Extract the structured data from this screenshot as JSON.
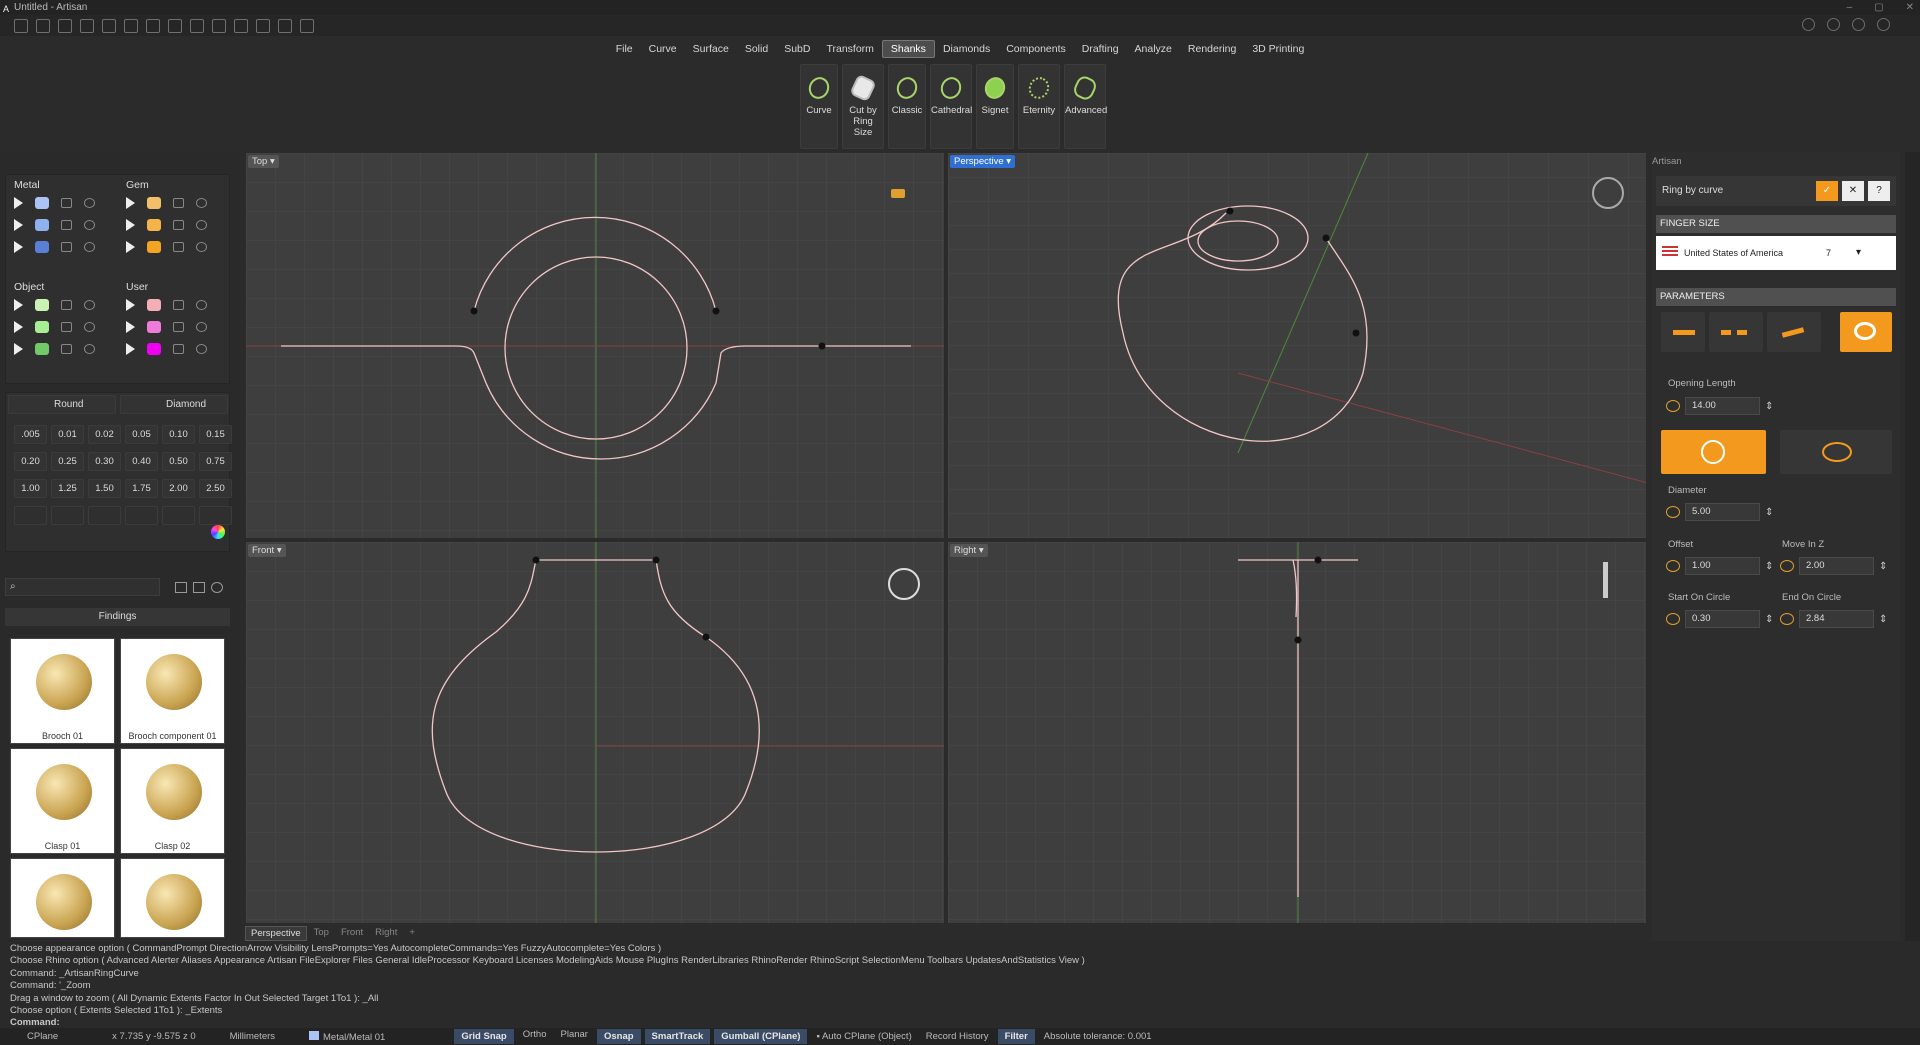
{
  "window": {
    "title": "Untitled - Artisan"
  },
  "menu": {
    "items": [
      "File",
      "Curve",
      "Surface",
      "Solid",
      "SubD",
      "Transform",
      "Shanks",
      "Diamonds",
      "Components",
      "Drafting",
      "Analyze",
      "Rendering",
      "3D Printing"
    ],
    "active": "Shanks"
  },
  "ribbon": {
    "buttons": [
      "Curve",
      "Cut by Ring Size",
      "Classic",
      "Cathedral",
      "Signet",
      "Eternity",
      "Advanced"
    ]
  },
  "layers": {
    "groups": [
      {
        "title": "Metal",
        "colors": [
          "#a9c4f5",
          "#8fb1ee",
          "#5a7fd6"
        ]
      },
      {
        "title": "Gem",
        "colors": [
          "#f3c06a",
          "#f5b44a",
          "#f4a423"
        ]
      },
      {
        "title": "Object",
        "colors": [
          "#c9f3b4",
          "#a8ef94",
          "#72c96a"
        ]
      },
      {
        "title": "User",
        "colors": [
          "#f6aeb6",
          "#f07ad8",
          "#f000f0"
        ]
      }
    ]
  },
  "stones": {
    "shapes": [
      "Round",
      "Diamond"
    ],
    "sizes": [
      ".005",
      "0.01",
      "0.02",
      "0.05",
      "0.10",
      "0.15",
      "0.20",
      "0.25",
      "0.30",
      "0.40",
      "0.50",
      "0.75",
      "1.00",
      "1.25",
      "1.50",
      "1.75",
      "2.00",
      "2.50"
    ]
  },
  "library": {
    "category": "Findings",
    "items": [
      "Brooch 01",
      "Brooch component 01",
      "Clasp 01",
      "Clasp 02",
      "",
      ""
    ]
  },
  "viewports": {
    "top": "Top",
    "perspective": "Perspective",
    "front": "Front",
    "right": "Right",
    "tabs": [
      "Perspective",
      "Top",
      "Front",
      "Right"
    ],
    "add": "+"
  },
  "panel": {
    "header": "Artisan",
    "command": "Ring by curve",
    "finger_size_title": "FINGER SIZE",
    "country": "United States of America",
    "size": "7",
    "parameters_title": "PARAMETERS",
    "opening_length_label": "Opening Length",
    "opening_length": "14.00",
    "diameter_label": "Diameter",
    "diameter": "5.00",
    "offset_label": "Offset",
    "offset": "1.00",
    "move_z_label": "Move In Z",
    "move_z": "2.00",
    "start_circle_label": "Start On Circle",
    "start_circle": "0.30",
    "end_circle_label": "End On Circle",
    "end_circle": "2.84"
  },
  "command": {
    "lines": [
      "Choose appearance option ( CommandPrompt  DirectionArrow  Visibility  LensPrompts=Yes  AutocompleteCommands=Yes  FuzzyAutocomplete=Yes  Colors )",
      "Choose Rhino option ( Advanced  Alerter  Aliases  Appearance  Artisan  FileExplorer  Files  General  IdleProcessor  Keyboard  Licenses  ModelingAids  Mouse  PlugIns  RenderLibraries  RhinoRender  RhinoScript  SelectionMenu  Toolbars  UpdatesAndStatistics  View )",
      "Command: _ArtisanRingCurve",
      "Command: '_Zoom",
      "Drag a window to zoom ( All  Dynamic  Extents  Factor  In  Out  Selected  Target  1To1 ): _All",
      "Choose option ( Extents  Selected  1To1 ): _Extents"
    ],
    "prompt": "Command:"
  },
  "status": {
    "cplane": "CPlane",
    "coords": "x 7.735  y -9.575  z 0",
    "units": "Millimeters",
    "layer": "Metal/Metal 01",
    "toggles": [
      "Grid Snap",
      "Ortho",
      "Planar",
      "Osnap",
      "SmartTrack",
      "Gumball (CPlane)"
    ],
    "toggles_on": [
      true,
      false,
      false,
      true,
      true,
      true
    ],
    "auto_cplane": "Auto CPlane (Object)",
    "record": "Record History",
    "filter": "Filter",
    "tolerance": "Absolute tolerance: 0.001"
  }
}
